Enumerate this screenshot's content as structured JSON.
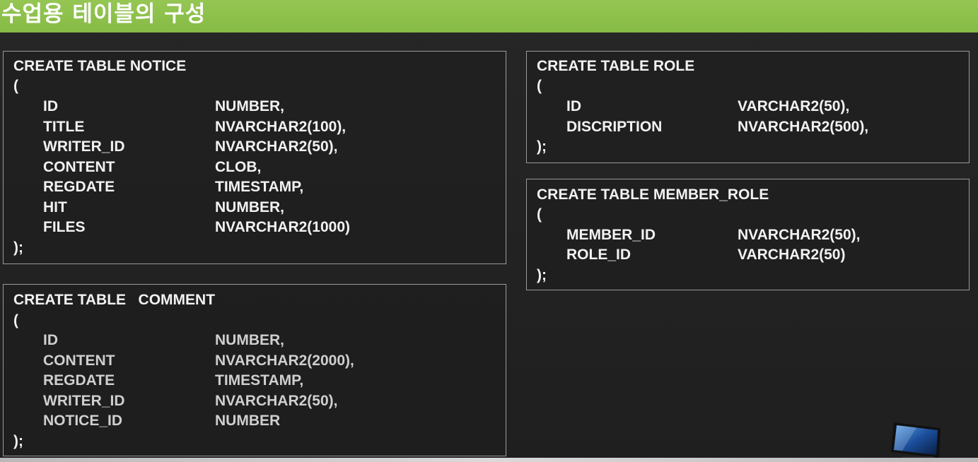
{
  "header": {
    "title": "수업용 테이블의 구성"
  },
  "tables": {
    "notice": {
      "create_line": "CREATE TABLE NOTICE",
      "open_paren": "(",
      "close_line": ");",
      "fields": [
        {
          "name": "ID",
          "type": "NUMBER,"
        },
        {
          "name": "TITLE",
          "type": "NVARCHAR2(100),"
        },
        {
          "name": "WRITER_ID",
          "type": "NVARCHAR2(50),"
        },
        {
          "name": "CONTENT",
          "type": "CLOB,"
        },
        {
          "name": "REGDATE",
          "type": "TIMESTAMP,"
        },
        {
          "name": "HIT",
          "type": "NUMBER,"
        },
        {
          "name": "FILES",
          "type": "NVARCHAR2(1000)"
        }
      ]
    },
    "comment": {
      "create_line": "CREATE TABLE   COMMENT",
      "open_paren": "(",
      "close_line": ");",
      "fields": [
        {
          "name": "ID",
          "type": "NUMBER,"
        },
        {
          "name": "CONTENT",
          "type": "NVARCHAR2(2000),"
        },
        {
          "name": "REGDATE",
          "type": "TIMESTAMP,"
        },
        {
          "name": "WRITER_ID",
          "type": "NVARCHAR2(50),"
        },
        {
          "name": "NOTICE_ID",
          "type": "NUMBER"
        }
      ]
    },
    "role": {
      "create_line": "CREATE TABLE ROLE",
      "open_paren": "(",
      "close_line": ");",
      "fields": [
        {
          "name": "ID",
          "type": "VARCHAR2(50),"
        },
        {
          "name": "DISCRIPTION",
          "type": "NVARCHAR2(500),"
        }
      ]
    },
    "member_role": {
      "create_line": "CREATE TABLE MEMBER_ROLE",
      "open_paren": "(",
      "close_line": ");",
      "fields": [
        {
          "name": "MEMBER_ID",
          "type": "NVARCHAR2(50),"
        },
        {
          "name": "ROLE_ID",
          "type": "VARCHAR2(50)"
        }
      ]
    }
  },
  "colors": {
    "header_green": "#8bc34a",
    "background": "#232323",
    "text": "#f2f2f2",
    "box_border": "#9a9a9a"
  },
  "icons": {
    "corner": "monitor-icon"
  }
}
